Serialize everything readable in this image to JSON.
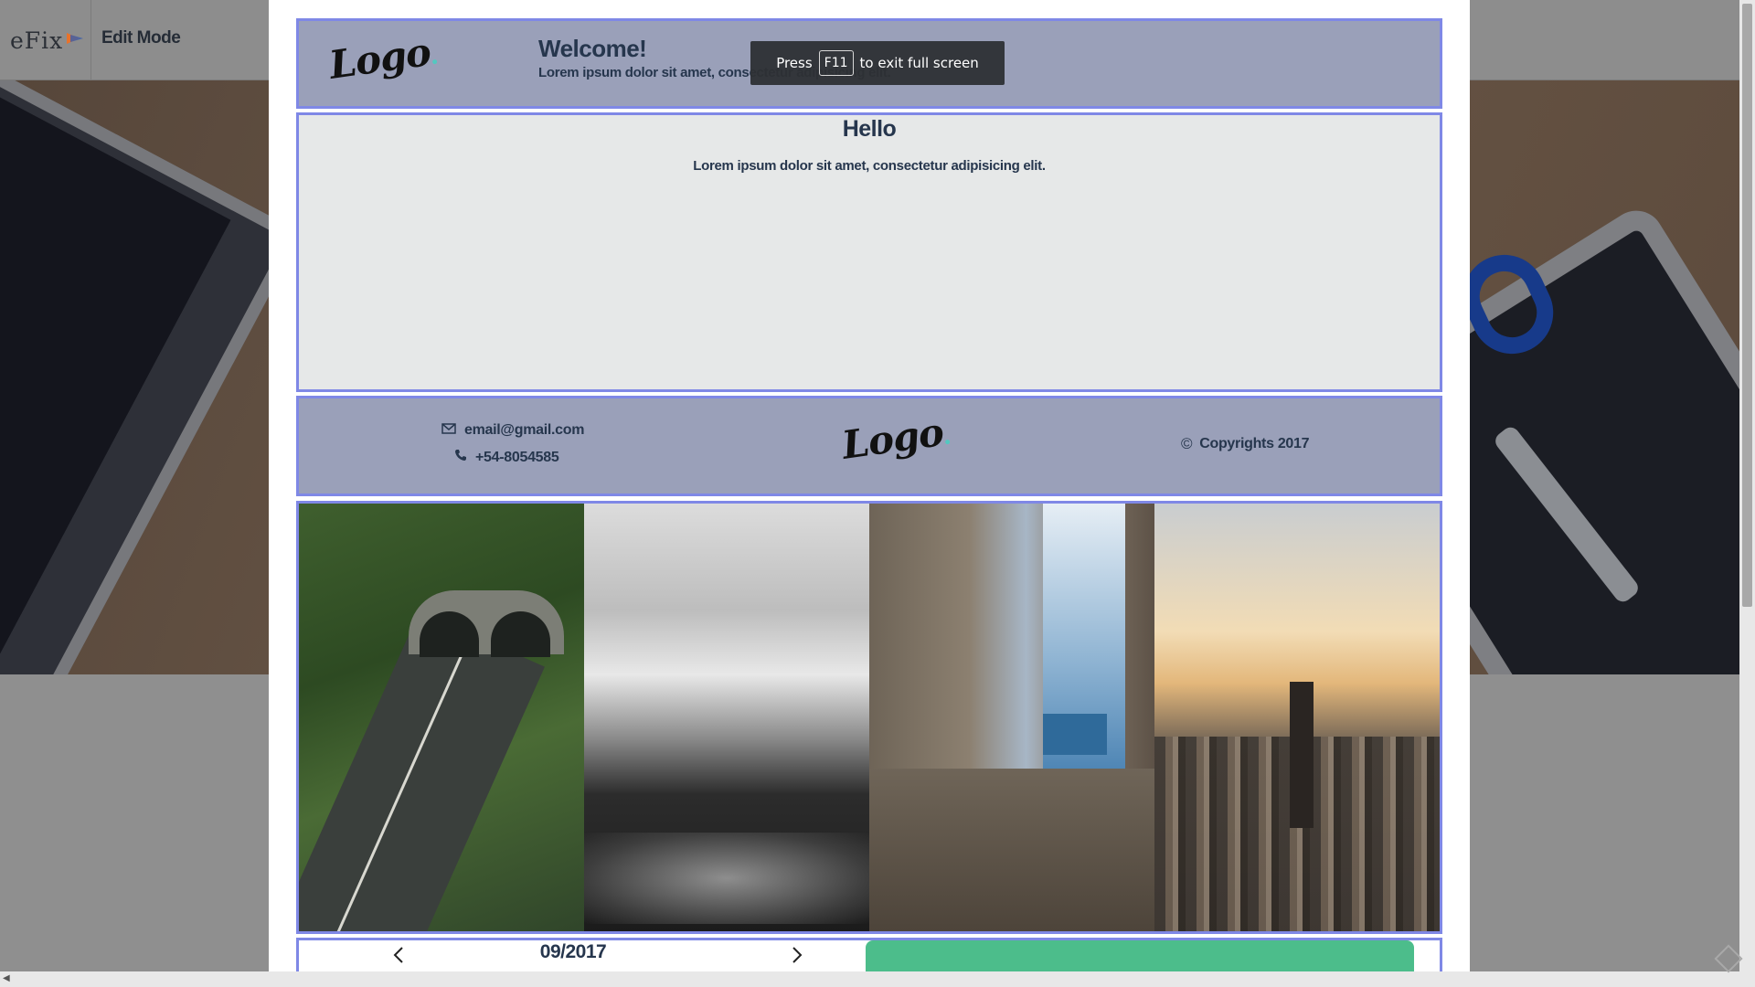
{
  "topbar": {
    "brand": "eFix",
    "brand_icon": "efix-logo-icon",
    "edit_mode_label": "Edit Mode"
  },
  "modal": {
    "header": {
      "logo_text": "Logo",
      "title": "Welcome!",
      "subtitle": "Lorem ipsum dolor sit amet, consectetur adipisicing elit."
    },
    "hello": {
      "title": "Hello",
      "text": "Lorem ipsum dolor sit amet, consectetur adipisicing elit."
    },
    "footer": {
      "email": "email@gmail.com",
      "email_icon": "envelope-icon",
      "phone": "+54-8054585",
      "phone_icon": "phone-icon",
      "logo_text": "Logo",
      "copyright_symbol": "©",
      "copyright": "Copyrights 2017"
    },
    "gallery": {
      "photos": [
        "tunnel-road-photo",
        "clouds-mountains-photo",
        "alley-sea-photo",
        "city-skyline-photo"
      ]
    },
    "nav": {
      "date": "09/2017",
      "prev_icon": "chevron-left-icon",
      "next_icon": "chevron-right-icon"
    }
  },
  "toast": {
    "before": "Press",
    "key": "F11",
    "after": "to exit full screen"
  },
  "colors": {
    "section_border": "#7f88e6",
    "band_bg": "#9aa0b9",
    "text_dark": "#26364d",
    "accent_green": "#4cbd8b"
  }
}
